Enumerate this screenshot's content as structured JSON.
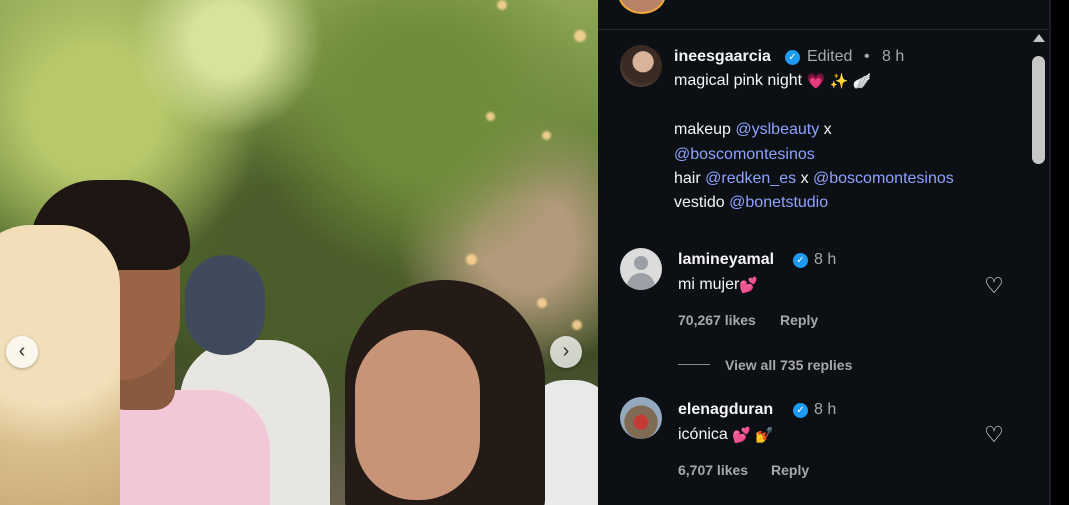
{
  "post": {
    "author": "ineesgaarcia",
    "edited_label": "Edited",
    "dot": "•",
    "time": "8 h",
    "caption_line1": "magical pink night",
    "caption_emojis": [
      "💗",
      "✨",
      "🪽"
    ],
    "makeup_label": "makeup",
    "makeup_mention1": "@yslbeauty",
    "x1": "x",
    "makeup_mention2": "@boscomontesinos",
    "hair_label": "hair",
    "hair_mention1": "@redken_es",
    "x2": "x",
    "hair_mention2": "@boscomontesinos",
    "vestido_label": "vestido",
    "vestido_mention": "@bonetstudio"
  },
  "comments": [
    {
      "author": "lamineyamal",
      "time": "8 h",
      "text": "mi mujer",
      "emoji": "💕",
      "likes": "70,267 likes",
      "reply_label": "Reply",
      "view_replies": "View all 735 replies"
    },
    {
      "author": "elenagduran",
      "time": "8 h",
      "text": "icónica",
      "emoji1": "💕",
      "emoji2": "💅",
      "likes": "6,707 likes",
      "reply_label": "Reply"
    }
  ],
  "icons": {
    "verified": "verified-badge-icon",
    "like": "heart-outline-icon",
    "prev": "chevron-left-icon",
    "next": "chevron-right-icon"
  },
  "glyphs": {
    "verified": "✓",
    "heart": "♡",
    "prev": "‹",
    "next": "›"
  },
  "colors": {
    "panel_bg": "#0c0f14",
    "mention": "#8ea3ff",
    "verified": "#1d9bf0",
    "muted": "#a8a8a8"
  }
}
